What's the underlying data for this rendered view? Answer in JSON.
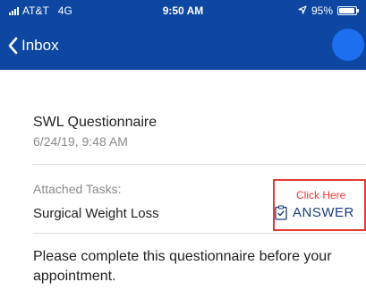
{
  "status_bar": {
    "carrier": "AT&T",
    "network": "4G",
    "time": "9:50 AM",
    "battery_percent": "95%",
    "battery_level": 0.95,
    "icons": [
      "signal-icon",
      "location-arrow-icon",
      "battery-icon"
    ]
  },
  "nav": {
    "back_label": "Inbox",
    "icons": [
      "back-chevron-icon"
    ]
  },
  "message": {
    "title": "SWL Questionnaire",
    "date": "6/24/19, 9:48 AM",
    "attached_tasks_label": "Attached Tasks:",
    "task_name": "Surgical Weight Loss",
    "click_here": "Click Here",
    "answer_label": "ANSWER",
    "body": "Please complete this questionnaire before your appointment."
  },
  "colors": {
    "header_bg": "#0d47a1",
    "profile_circle": "#1e6ff0",
    "highlight": "#e53935",
    "answer_text": "#1a3d7a"
  }
}
